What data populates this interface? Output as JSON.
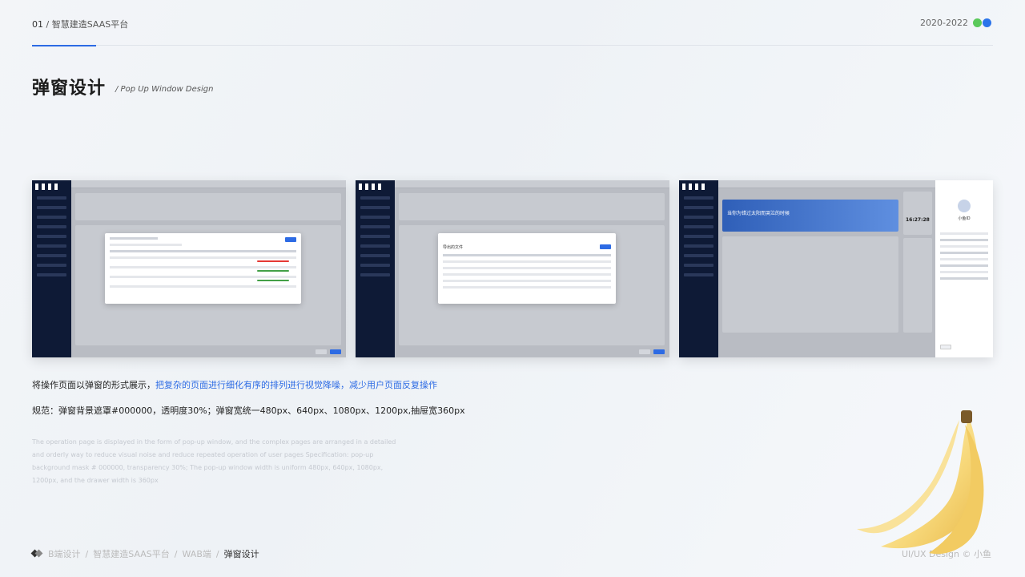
{
  "header": {
    "page_num": "01",
    "section": "智慧建造SAAS平台",
    "years": "2020-2022"
  },
  "title": "弹窗设计",
  "subtitle": "/ Pop Up Window Design",
  "description": {
    "intro": "将操作页面以弹窗的形式展示，",
    "highlight": "把复杂的页面进行细化有序的排列进行视觉降噪，减少用户页面反复操作",
    "spec": "规范：弹窗背景遮罩#000000，透明度30%；弹窗宽统一480px、640px、1080px、1200px,抽屉宽360px",
    "english": "The operation page is displayed in the form of pop-up window, and the complex pages are arranged in a detailed and orderly way to reduce visual noise and reduce repeated operation of user pages Specification: pop-up background mask # 000000, transparency 30%; The pop-up window width is uniform 480px, 640px, 1080px, 1200px, and the drawer width is 360px"
  },
  "screens": {
    "shot2_title": "导出的文件",
    "shot3_banner": "当你为错过太阳而哭泣的时候",
    "shot3_time": "16:27:28",
    "shot3_user": "小鱼ID"
  },
  "footer": {
    "crumb1": "B端设计",
    "crumb2": "智慧建造SAAS平台",
    "crumb3": "WAB端",
    "crumb_current": "弹窗设计",
    "copyright": "UI/UX Design © 小鱼"
  },
  "colors": {
    "accent": "#2d6be4",
    "sidebar": "#0e1a36",
    "mask": "#000000"
  }
}
